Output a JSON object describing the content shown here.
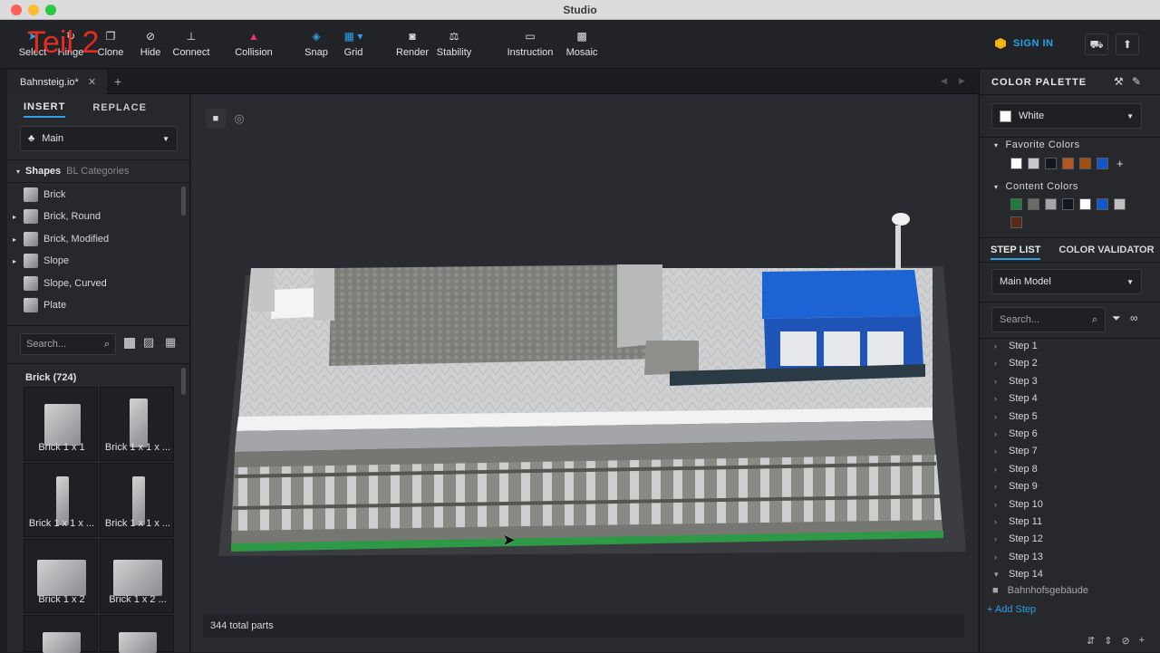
{
  "window": {
    "title": "Studio"
  },
  "overlay": {
    "text": "Teil 2"
  },
  "toolbar": {
    "tools": [
      {
        "name": "select",
        "label": "Select",
        "icon": "cursor-icon"
      },
      {
        "name": "hinge",
        "label": "Hinge",
        "icon": "hinge-icon"
      },
      {
        "name": "clone",
        "label": "Clone",
        "icon": "clone-icon"
      },
      {
        "name": "hide",
        "label": "Hide",
        "icon": "eye-slash-icon"
      },
      {
        "name": "connect",
        "label": "Connect",
        "icon": "connect-icon"
      },
      {
        "name": "collision",
        "label": "Collision",
        "icon": "warning-triangle-icon"
      },
      {
        "name": "snap",
        "label": "Snap",
        "icon": "snap-icon"
      },
      {
        "name": "grid",
        "label": "Grid",
        "icon": "grid-icon"
      },
      {
        "name": "render",
        "label": "Render",
        "icon": "camera-icon"
      },
      {
        "name": "stability",
        "label": "Stability",
        "icon": "stability-icon"
      },
      {
        "name": "instruction",
        "label": "Instruction",
        "icon": "book-icon"
      },
      {
        "name": "mosaic",
        "label": "Mosaic",
        "icon": "mosaic-icon"
      }
    ],
    "sign_in": "SIGN IN",
    "accent": "#23a7f0"
  },
  "tabs": {
    "doc_name": "Bahnsteig.io*",
    "close": "✕",
    "add": "+"
  },
  "left": {
    "tab_insert": "INSERT",
    "tab_replace": "REPLACE",
    "model_select": "Main",
    "shapes_label": "Shapes",
    "bl_label": "BL Categories",
    "shapes": [
      "Brick",
      "Brick, Round",
      "Brick, Modified",
      "Slope",
      "Slope, Curved",
      "Plate"
    ],
    "search_placeholder": "Search...",
    "parts_title": "Brick (724)",
    "parts": [
      "Brick 1 x 1",
      "Brick 1 x 1 x ...",
      "Brick 1 x 1 x ...",
      "Brick 1 x 1 x ...",
      "Brick 1 x 2",
      "Brick 1 x 2 ..."
    ]
  },
  "viewport": {
    "status": "344 total parts"
  },
  "right": {
    "palette_title": "COLOR PALETTE",
    "color_select": "White",
    "favorite_title": "Favorite Colors",
    "favorite_colors": [
      "#ffffff",
      "#c9c9c9",
      "#10171f",
      "#b5561f",
      "#a24f12",
      "#1257c7"
    ],
    "content_title": "Content Colors",
    "content_colors": [
      "#1f7a3b",
      "#6a6c6a",
      "#a3a5a7",
      "#10171f",
      "#ffffff",
      "#1257c7",
      "#c0c0c0",
      "#5a2a14"
    ],
    "step_list": "STEP LIST",
    "color_validator": "COLOR VALIDATOR",
    "model_select": "Main Model",
    "search_placeholder": "Search...",
    "steps": [
      "Step 1",
      "Step 2",
      "Step 3",
      "Step 4",
      "Step 5",
      "Step 6",
      "Step 7",
      "Step 8",
      "Step 9",
      "Step 10",
      "Step 11",
      "Step 12",
      "Step 13",
      "Step 14"
    ],
    "sub_item": "Bahnhofsgebäude",
    "add_step": "+ Add Step"
  }
}
